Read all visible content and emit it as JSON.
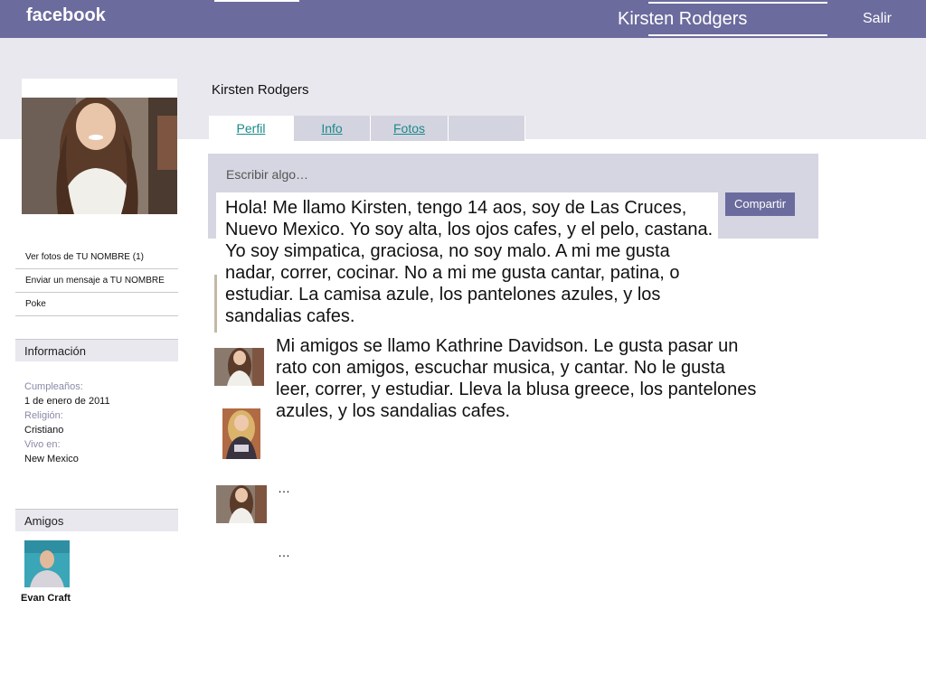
{
  "topbar": {
    "logo": "facebook",
    "user_name": "Kirsten Rodgers",
    "exit_label": "Salir"
  },
  "sidebar": {
    "links": [
      {
        "label": "Ver fotos de TU NOMBRE (1)"
      },
      {
        "label": "Enviar un mensaje a TU NOMBRE"
      },
      {
        "label": "Poke"
      }
    ],
    "info_heading": "Información",
    "info": {
      "birthday_label": "Cumpleaños:",
      "birthday_value": "1 de enero de 2011",
      "religion_label": "Religión:",
      "religion_value": "Cristiano",
      "lives_label": "Vivo en:",
      "lives_value": "New Mexico"
    },
    "friends_heading": "Amigos",
    "friend_name": "Evan Craft"
  },
  "main": {
    "profile_name": "Kirsten  Rodgers",
    "tabs": [
      {
        "label": "Perfil"
      },
      {
        "label": "Info"
      },
      {
        "label": "Fotos"
      },
      {
        "label": ""
      }
    ],
    "composer_placeholder": "Escribir algo…",
    "share_label": "Compartir",
    "status_text": "Hola! Me llamo Kirsten, tengo 14 aos, soy de Las Cruces, Nuevo Mexico. Yo soy alta, los ojos cafes, y el pelo, castana. Yo soy simpatica, graciosa, no soy malo. A mi me gusta nadar, correr, cocinar. No a mi me gusta cantar, patina, o estudiar. La camisa azule, los pantelones azules, y los sandalias cafes.",
    "feed_text": "Mi amigos se llamo Kathrine Davidson. Le gusta pasar un rato con amigos, escuchar musica, y cantar. No le gusta leer, correr, y estudiar. Lleva la blusa greece, los pantelones azules, y los sandalias cafes.",
    "ellipsis_1": "…",
    "ellipsis_2": "…"
  }
}
